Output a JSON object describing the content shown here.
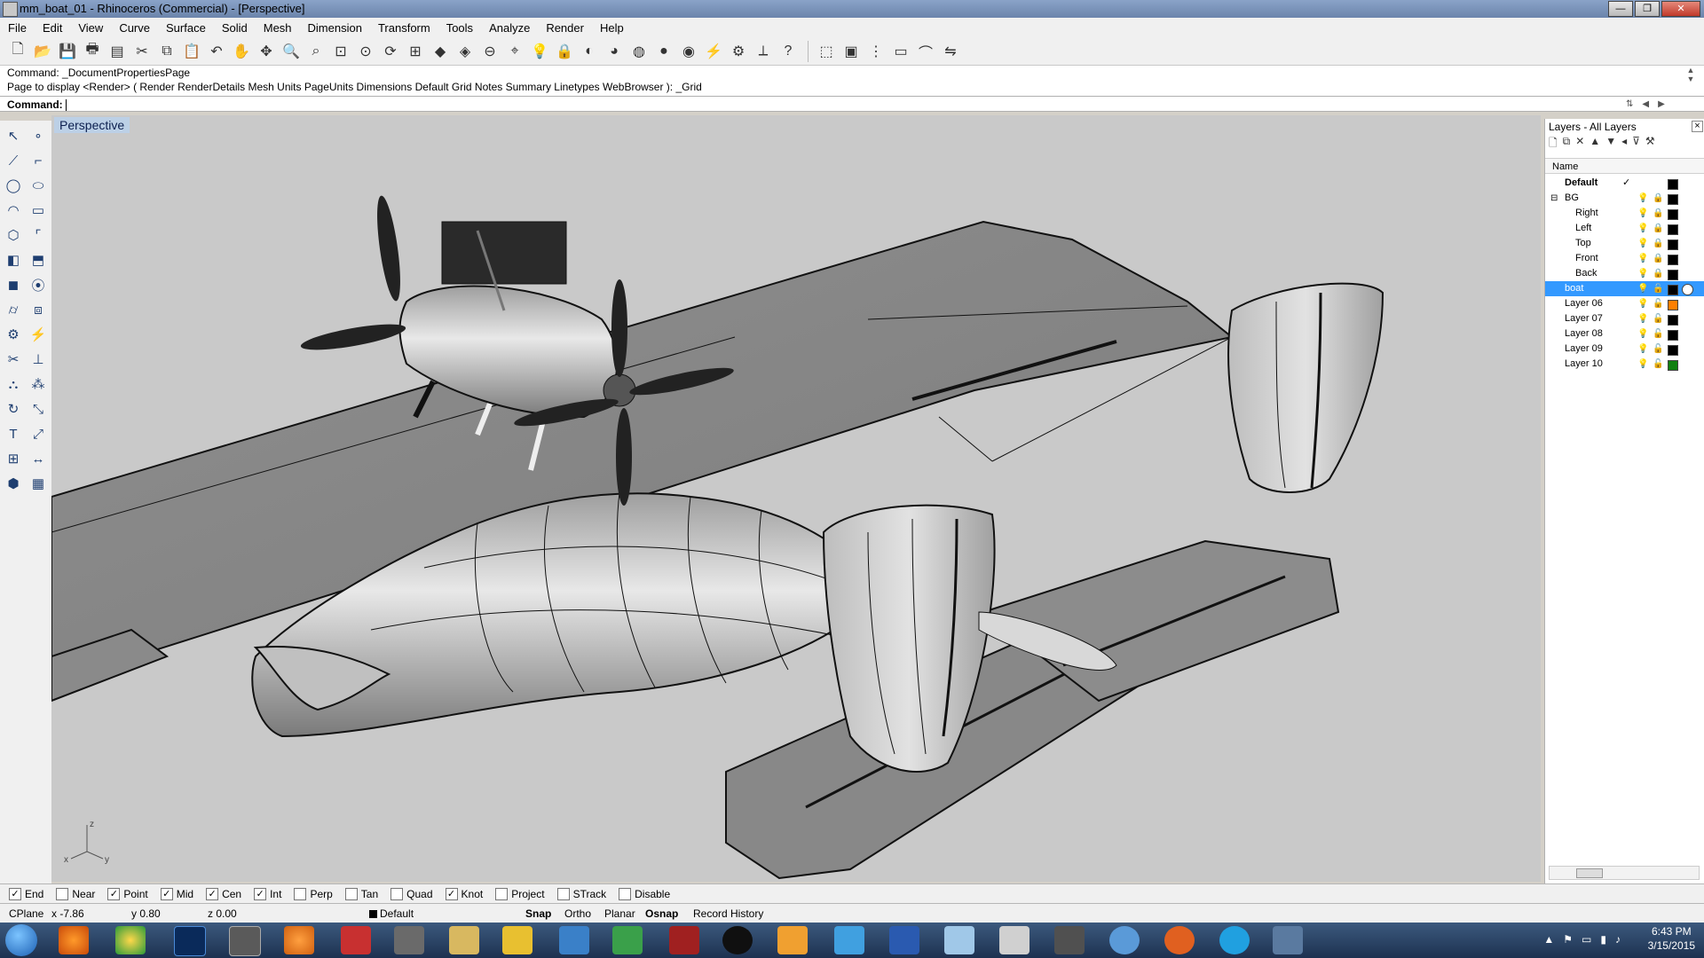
{
  "window": {
    "title": "mm_boat_01 - Rhinoceros (Commercial) - [Perspective]"
  },
  "menu": [
    "File",
    "Edit",
    "View",
    "Curve",
    "Surface",
    "Solid",
    "Mesh",
    "Dimension",
    "Transform",
    "Tools",
    "Analyze",
    "Render",
    "Help"
  ],
  "command_history": [
    "Command: _DocumentPropertiesPage",
    "Page to display <Render> ( Render  RenderDetails  Mesh  Units  PageUnits  Dimensions  Default  Grid  Notes  Summary  Linetypes  WebBrowser ): _Grid"
  ],
  "command_prompt": "Command:",
  "viewport": {
    "title": "Perspective"
  },
  "axes": {
    "x": "x",
    "y": "y",
    "z": "z"
  },
  "layers": {
    "header": "Layers - All Layers",
    "column": "Name",
    "rows": [
      {
        "name": "Default",
        "current": true,
        "checkmark": "✓",
        "color": "#000000",
        "level": 0
      },
      {
        "name": "BG",
        "expander": "⊟",
        "color": "#000000",
        "level": 0
      },
      {
        "name": "Right",
        "color": "#000000",
        "level": 1
      },
      {
        "name": "Left",
        "color": "#000000",
        "level": 1
      },
      {
        "name": "Top",
        "color": "#000000",
        "level": 1
      },
      {
        "name": "Front",
        "color": "#000000",
        "level": 1
      },
      {
        "name": "Back",
        "color": "#000000",
        "level": 1
      },
      {
        "name": "boat",
        "selected": true,
        "color": "#000000",
        "level": 0
      },
      {
        "name": "Layer 06",
        "color": "#ff7f00",
        "level": 0
      },
      {
        "name": "Layer 07",
        "color": "#000000",
        "level": 0
      },
      {
        "name": "Layer 08",
        "color": "#000000",
        "level": 0
      },
      {
        "name": "Layer 09",
        "color": "#000000",
        "level": 0
      },
      {
        "name": "Layer 10",
        "color": "#108010",
        "level": 0
      }
    ]
  },
  "osnaps": [
    {
      "label": "End",
      "checked": true
    },
    {
      "label": "Near",
      "checked": false
    },
    {
      "label": "Point",
      "checked": true
    },
    {
      "label": "Mid",
      "checked": true
    },
    {
      "label": "Cen",
      "checked": true
    },
    {
      "label": "Int",
      "checked": true
    },
    {
      "label": "Perp",
      "checked": false
    },
    {
      "label": "Tan",
      "checked": false
    },
    {
      "label": "Quad",
      "checked": false
    },
    {
      "label": "Knot",
      "checked": true
    },
    {
      "label": "Project",
      "checked": false
    },
    {
      "label": "STrack",
      "checked": false
    },
    {
      "label": "Disable",
      "checked": false
    }
  ],
  "status": {
    "cplane": "CPlane",
    "x": "x -7.86",
    "y": "y 0.80",
    "z": "z 0.00",
    "layer": "Default",
    "snap": "Snap",
    "ortho": "Ortho",
    "planar": "Planar",
    "osnap": "Osnap",
    "record_history": "Record History"
  },
  "clock": {
    "time": "6:43 PM",
    "date": "3/15/2015"
  },
  "colors": {
    "viewport_bg": "#c9c9c9",
    "selection": "#3399ff",
    "viewport_tab": "#bcd0e6"
  }
}
